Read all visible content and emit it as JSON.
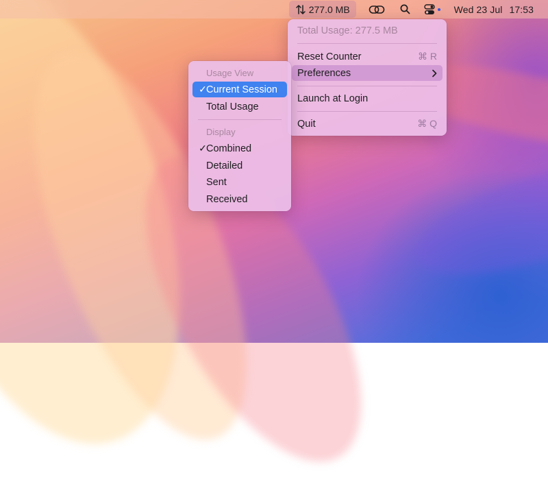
{
  "menubar": {
    "usage_label": "277.0 MB",
    "date": "Wed 23 Jul",
    "time": "17:53",
    "icons": [
      "arrows-up-down-icon",
      "link-icon",
      "search-icon",
      "control-center-icon"
    ]
  },
  "main_menu": {
    "total_usage": "Total Usage: 277.5 MB",
    "reset_label": "Reset Counter",
    "reset_shortcut": "⌘ R",
    "preferences_label": "Preferences",
    "launch_label": "Launch at Login",
    "quit_label": "Quit",
    "quit_shortcut": "⌘ Q"
  },
  "sub_menu": {
    "usage_view_header": "Usage View",
    "current_session": "Current Session",
    "total_usage": "Total Usage",
    "display_header": "Display",
    "combined": "Combined",
    "detailed": "Detailed",
    "sent": "Sent",
    "received": "Received",
    "checkmark": "✓"
  },
  "colors": {
    "selection": "#3f82f0"
  }
}
